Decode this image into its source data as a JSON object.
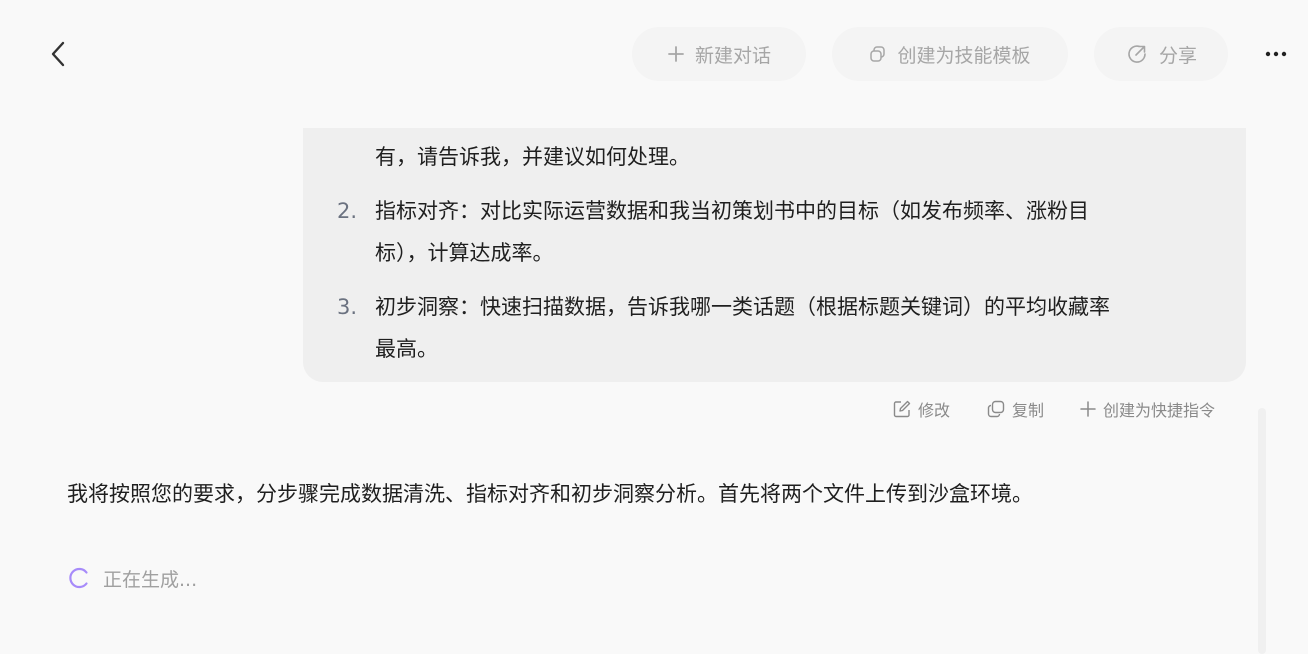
{
  "header": {
    "new_chat_label": "新建对话",
    "create_skill_label": "创建为技能模板",
    "share_label": "分享"
  },
  "user_message": {
    "cont_line": "有，请告诉我，并建议如何处理。",
    "items": [
      {
        "number": "2.",
        "lines": [
          "指标对齐：对比实际运营数据和我当初策划书中的目标（如发布频率、涨粉目",
          "标），计算达成率。"
        ]
      },
      {
        "number": "3.",
        "lines": [
          "初步洞察：快速扫描数据，告诉我哪一类话题（根据标题关键词）的平均收藏率",
          "最高。"
        ]
      }
    ]
  },
  "message_actions": {
    "edit_label": "修改",
    "copy_label": "复制",
    "shortcut_label": "创建为快捷指令"
  },
  "assistant": {
    "text": "我将按照您的要求，分步骤完成数据清洗、指标对齐和初步洞察分析。首先将两个文件上传到沙盒环境。",
    "status": "正在生成..."
  },
  "colors": {
    "background": "#f9f9f9",
    "bubble": "#efefef",
    "spinner": "#a78bfa"
  },
  "icons": [
    "chevron-left-icon",
    "plus-icon",
    "layers-icon",
    "share-icon",
    "more-icon",
    "edit-icon",
    "copy-icon",
    "spinner-icon"
  ]
}
